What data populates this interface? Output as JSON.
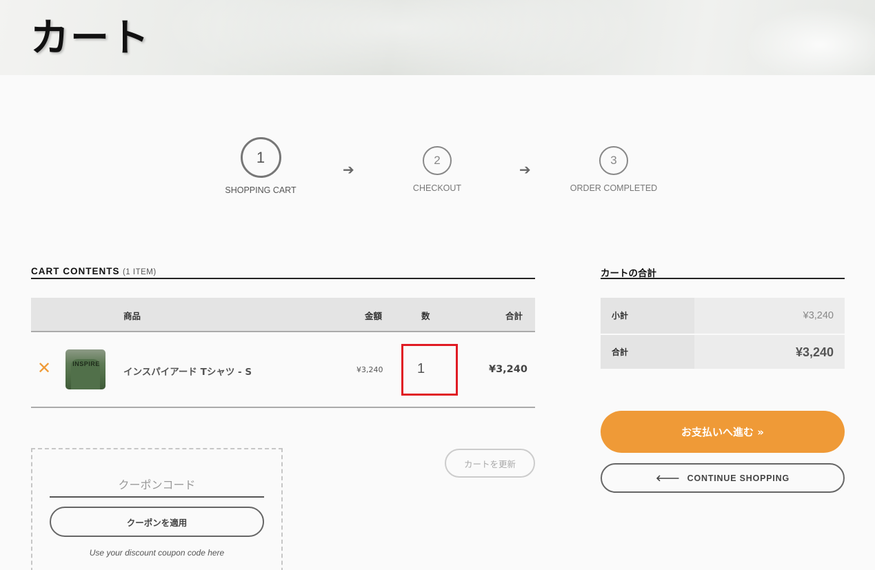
{
  "page": {
    "title": "カート"
  },
  "steps": [
    {
      "number": "1",
      "label": "SHOPPING CART"
    },
    {
      "number": "2",
      "label": "CHECKOUT"
    },
    {
      "number": "3",
      "label": "ORDER COMPLETED"
    }
  ],
  "step_arrow": "➔",
  "cart": {
    "title": "CART CONTENTS",
    "count": "(1 ITEM)",
    "headers": {
      "product": "商品",
      "price": "金額",
      "quantity": "数",
      "total": "合計"
    },
    "items": [
      {
        "remove_icon": "✕",
        "thumb_text": "INSPIRE",
        "name": "インスパイアード Tシャツ - S",
        "price": "¥3,240",
        "quantity": "1",
        "total": "¥3,240"
      }
    ],
    "update_label": "カートを更新"
  },
  "coupon": {
    "placeholder": "クーポンコード",
    "apply_label": "クーポンを適用",
    "hint": "Use your discount coupon code here"
  },
  "totals": {
    "title": "カートの合計",
    "subtotal_label": "小計",
    "subtotal_value": "¥3,240",
    "total_label": "合計",
    "total_value": "¥3,240"
  },
  "actions": {
    "checkout_label": "お支払いへ進む »",
    "continue_arrow": "🡐",
    "continue_label": "CONTINUE SHOPPING"
  },
  "colors": {
    "accent": "#ef9a37",
    "highlight": "#e01b24"
  }
}
